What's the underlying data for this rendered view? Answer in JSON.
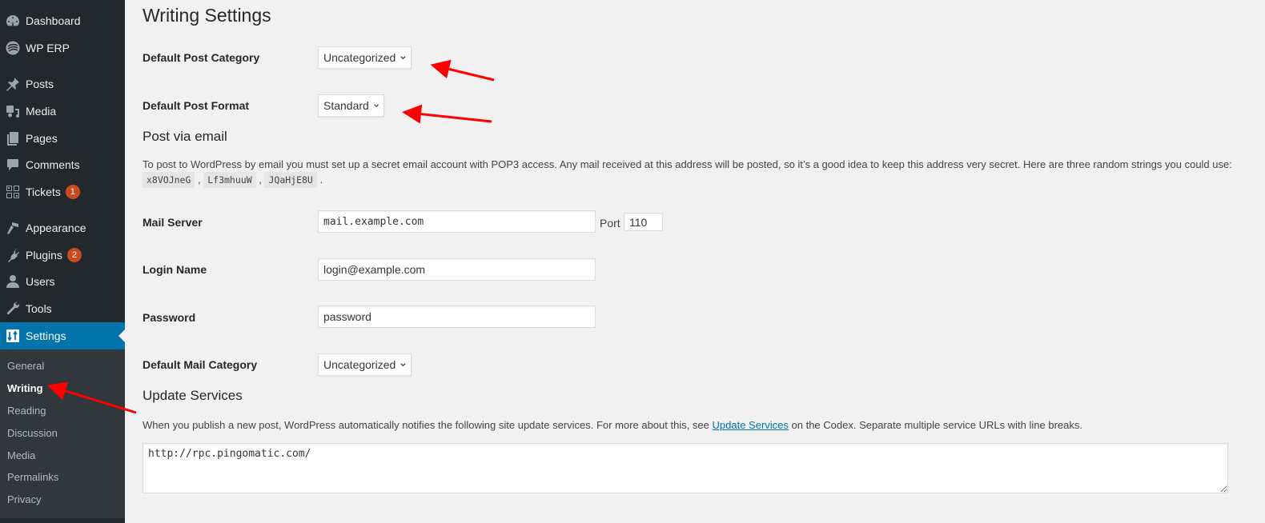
{
  "sidebar": {
    "menu": [
      {
        "label": "Dashboard",
        "icon": "dashboard-icon"
      },
      {
        "label": "WP ERP",
        "icon": "wp-erp-icon"
      },
      {
        "label": "Posts",
        "icon": "pushpin-icon"
      },
      {
        "label": "Media",
        "icon": "media-icon"
      },
      {
        "label": "Pages",
        "icon": "pages-icon"
      },
      {
        "label": "Comments",
        "icon": "comment-icon"
      },
      {
        "label": "Tickets",
        "icon": "tickets-icon",
        "badge": "1"
      },
      {
        "label": "Appearance",
        "icon": "paintbrush-icon"
      },
      {
        "label": "Plugins",
        "icon": "plugin-icon",
        "badge": "2"
      },
      {
        "label": "Users",
        "icon": "user-icon"
      },
      {
        "label": "Tools",
        "icon": "wrench-icon"
      },
      {
        "label": "Settings",
        "icon": "settings-icon",
        "active": true
      }
    ],
    "submenu": [
      "General",
      "Writing",
      "Reading",
      "Discussion",
      "Media",
      "Permalinks",
      "Privacy"
    ],
    "current_submenu": "Writing"
  },
  "page": {
    "title": "Writing Settings",
    "default_post_category": {
      "label": "Default Post Category",
      "value": "Uncategorized"
    },
    "default_post_format": {
      "label": "Default Post Format",
      "value": "Standard"
    },
    "post_via_email": {
      "heading": "Post via email",
      "description": "To post to WordPress by email you must set up a secret email account with POP3 access. Any mail received at this address will be posted, so it’s a good idea to keep this address very secret. Here are three random strings you could use:",
      "random_strings": [
        "x8VOJneG",
        "Lf3mhuuW",
        "JQaHjE8U"
      ],
      "mail_server": {
        "label": "Mail Server",
        "value": "mail.example.com"
      },
      "port": {
        "label": "Port",
        "value": "110"
      },
      "login_name": {
        "label": "Login Name",
        "value": "login@example.com"
      },
      "password": {
        "label": "Password",
        "value": "password"
      },
      "default_mail_category": {
        "label": "Default Mail Category",
        "value": "Uncategorized"
      }
    },
    "update_services": {
      "heading": "Update Services",
      "desc_before": "When you publish a new post, WordPress automatically notifies the following site update services. For more about this, see ",
      "link_text": "Update Services",
      "desc_after": " on the Codex. Separate multiple service URLs with line breaks.",
      "textarea_value": "http://rpc.pingomatic.com/"
    }
  },
  "annotations": {
    "arrow_color": "#ff0000"
  }
}
